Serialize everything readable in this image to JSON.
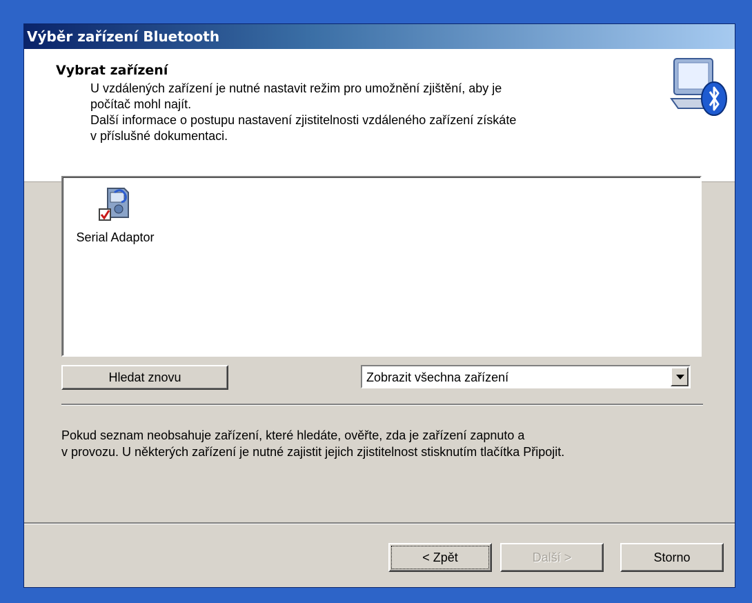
{
  "window": {
    "title": "Výběr zařízení Bluetooth"
  },
  "header": {
    "heading": "Vybrat zařízení",
    "description_lines": [
      "U vzdálených zařízení je nutné nastavit režim pro umožnění zjištění, aby je",
      "počítač mohl najít.",
      "Další informace o postupu nastavení zjistitelnosti vzdáleného zařízení získáte",
      "v příslušné dokumentaci."
    ],
    "icon": "bluetooth-computer-icon"
  },
  "device_list": {
    "items": [
      {
        "label": "Serial Adaptor",
        "icon": "serial-adaptor-icon",
        "checked": true
      }
    ]
  },
  "controls": {
    "search_again_label": "Hledat znovu",
    "filter": {
      "selected": "Zobrazit všechna zařízení"
    }
  },
  "note_lines": [
    "Pokud seznam neobsahuje zařízení, které hledáte, ověřte, zda je zařízení zapnuto a",
    "v provozu. U některých zařízení je nutné zajistit jejich zjistitelnost stisknutím tlačítka Připojit."
  ],
  "footer": {
    "back_label": "< Zpět",
    "next_label": "Další >",
    "cancel_label": "Storno"
  }
}
